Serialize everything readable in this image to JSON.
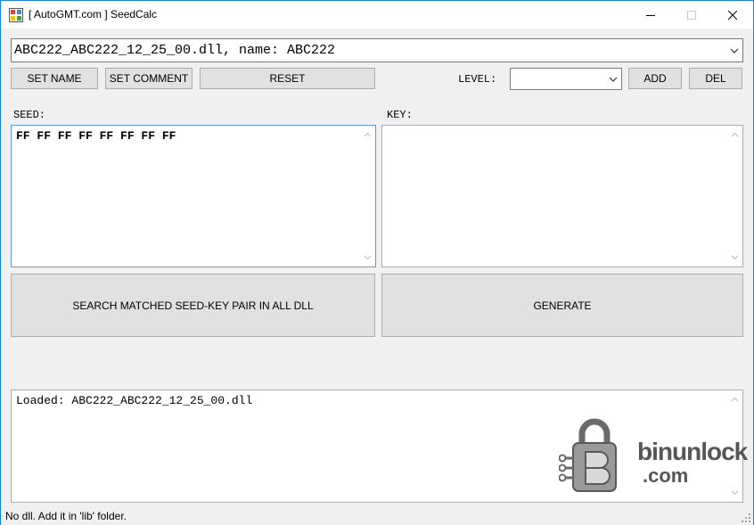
{
  "window": {
    "title": "[ AutoGMT.com ] SeedCalc"
  },
  "file_combo": {
    "value": "ABC222_ABC222_12_25_00.dll, name: ABC222"
  },
  "toolbar": {
    "set_name_label": "SET NAME",
    "set_comment_label": "SET COMMENT",
    "reset_label": "RESET",
    "level_label": "LEVEL:",
    "level_value": "",
    "add_label": "ADD",
    "del_label": "DEL"
  },
  "seed": {
    "label": "SEED:",
    "value": "FF FF FF FF FF FF FF FF"
  },
  "key": {
    "label": "KEY:",
    "value": ""
  },
  "actions": {
    "search_label": "SEARCH MATCHED SEED-KEY PAIR IN ALL DLL",
    "generate_label": "GENERATE"
  },
  "log": {
    "text": "Loaded: ABC222_ABC222_12_25_00.dll"
  },
  "status": {
    "text": "No dll. Add it in 'lib' folder."
  },
  "watermark": {
    "line1": "binunlock",
    "line2": ".com"
  },
  "colors": {
    "window_border": "#1883d7",
    "focus_border": "#5a9ad6",
    "button_bg": "#e1e1e1",
    "button_border": "#adadad"
  }
}
